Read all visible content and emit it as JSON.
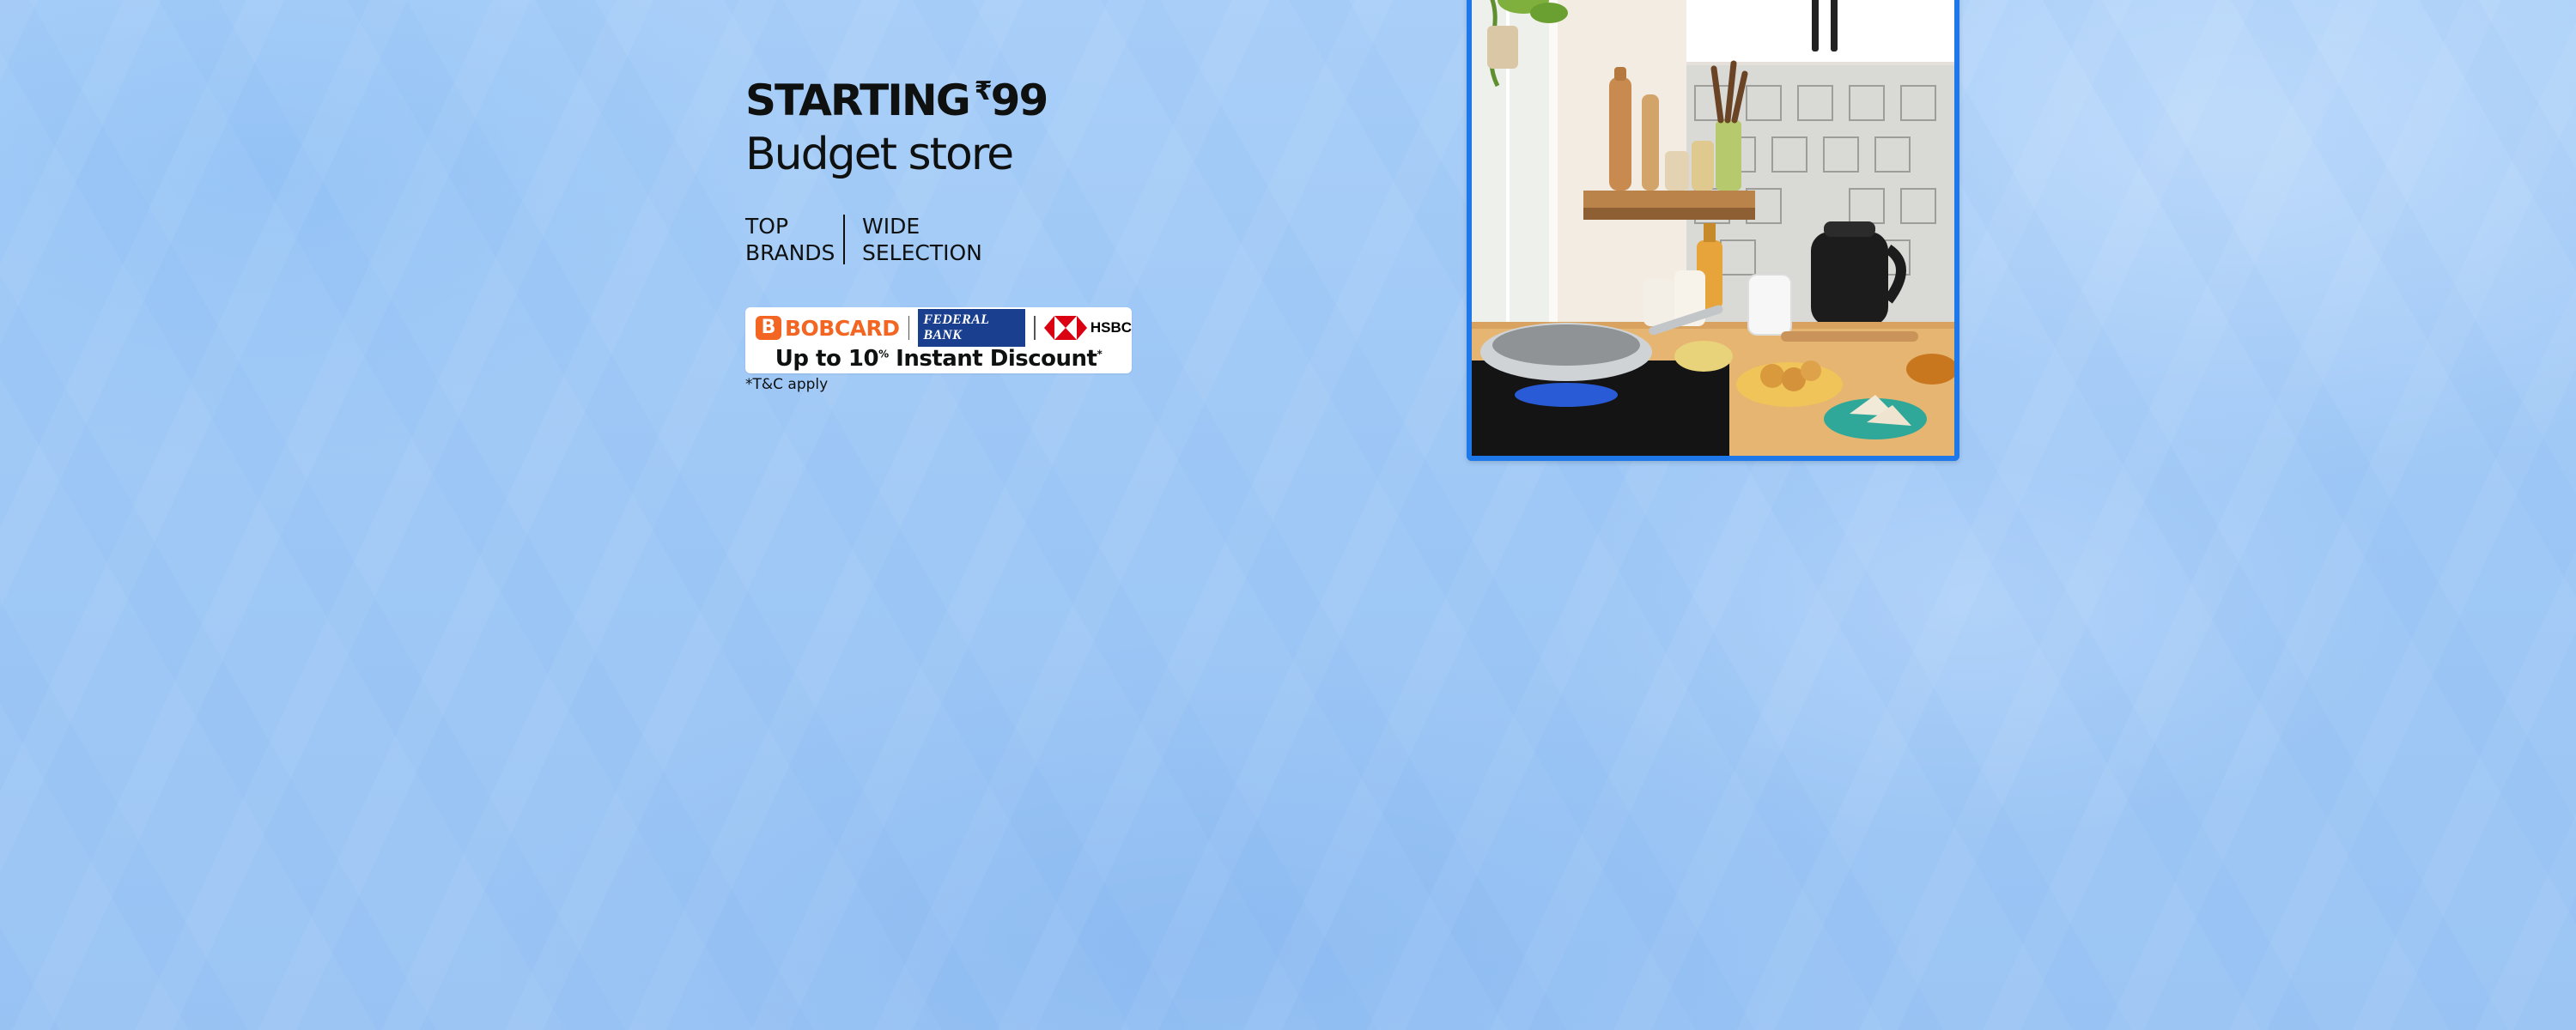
{
  "promo": {
    "headline": "STARTING",
    "currency": "₹",
    "price": "99",
    "subtitle": "Budget store",
    "features": [
      {
        "line1": "TOP",
        "line2": "BRANDS"
      },
      {
        "line1": "WIDE",
        "line2": "SELECTION"
      }
    ],
    "offer": {
      "bank_logos": [
        "BOBCARD",
        "FEDERAL BANK",
        "HSBC"
      ],
      "discount_prefix": "Up to 10",
      "discount_unit": "%",
      "discount_suffix": " Instant Discount",
      "asterisk": "*"
    },
    "terms": "*T&C apply"
  },
  "image": {
    "subject": "kitchen-scene",
    "icons": [
      "kitchen-scene-image"
    ]
  },
  "colors": {
    "background": "#a9cff8",
    "frame": "#1e78ea",
    "bobcard": "#f26522",
    "federal_bank": "#1b3f8f",
    "hsbc": "#db0011",
    "text": "#0f1111"
  }
}
